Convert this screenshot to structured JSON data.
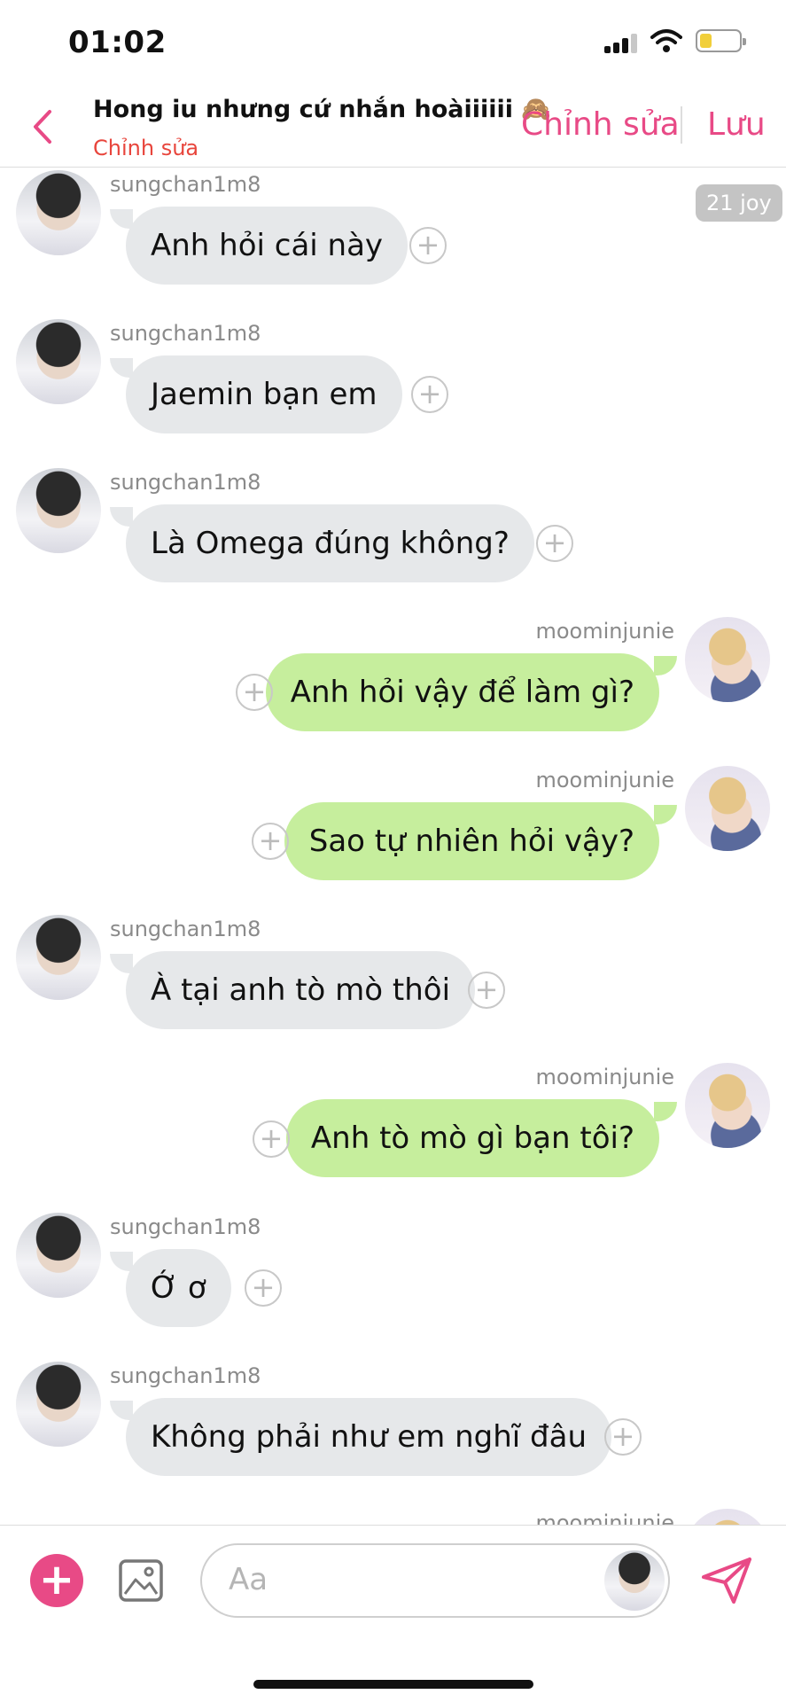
{
  "status_bar": {
    "time": "01:02"
  },
  "header": {
    "title": "Hong iu nhưng cứ nhắn hoàiiiiii 🙈",
    "subtitle": "Chỉnh sửa",
    "edit_label": "Chỉnh sửa",
    "save_label": "Lưu"
  },
  "badge": "21 joy",
  "messages": [
    {
      "side": "in",
      "user": "sungchan1m8",
      "text": "Anh hỏi cái này"
    },
    {
      "side": "in",
      "user": "sungchan1m8",
      "text": "Jaemin bạn em"
    },
    {
      "side": "in",
      "user": "sungchan1m8",
      "text": "Là Omega đúng không?"
    },
    {
      "side": "out",
      "user": "moominjunie",
      "text": "Anh hỏi vậy để làm gì?"
    },
    {
      "side": "out",
      "user": "moominjunie",
      "text": "Sao tự nhiên hỏi vậy?"
    },
    {
      "side": "in",
      "user": "sungchan1m8",
      "text": "À tại anh tò mò thôi"
    },
    {
      "side": "out",
      "user": "moominjunie",
      "text": "Anh tò mò gì bạn tôi?"
    },
    {
      "side": "in",
      "user": "sungchan1m8",
      "text": "Ớ ơ"
    },
    {
      "side": "in",
      "user": "sungchan1m8",
      "text": "Không phải như em nghĩ đâu"
    },
    {
      "side": "out",
      "user": "moominjunie",
      "text": ""
    }
  ],
  "composer": {
    "placeholder": "Aa"
  },
  "colors": {
    "accent": "#e84a86",
    "incoming_bubble": "#e6e8ea",
    "outgoing_bubble": "#c6ee9d",
    "subtitle": "#e8453c"
  }
}
